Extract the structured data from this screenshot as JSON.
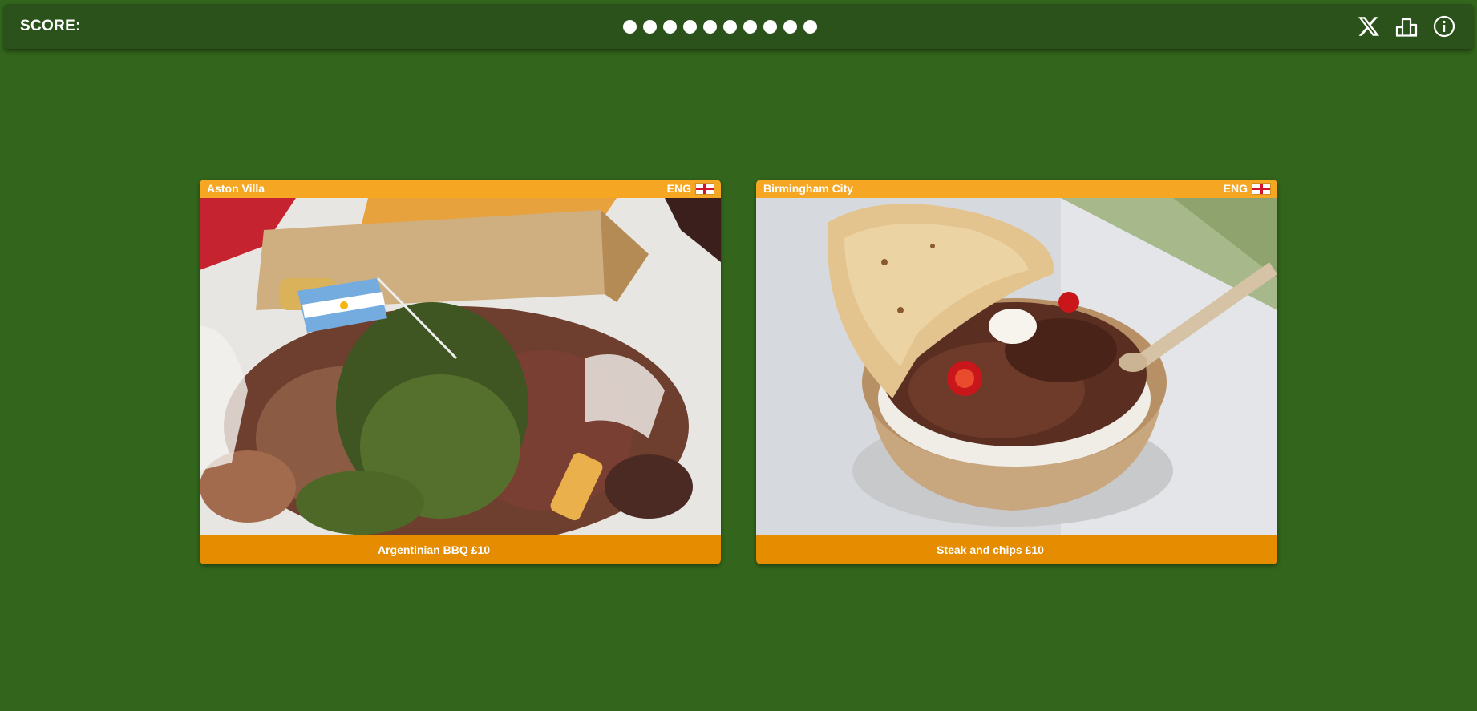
{
  "header": {
    "score_label": "SCORE:",
    "progress_dots": 10,
    "icons": [
      "x-logo-icon",
      "leaderboard-icon",
      "info-icon"
    ]
  },
  "cards": [
    {
      "club": "Aston Villa",
      "country": "ENG",
      "flag": "england-flag-icon",
      "photo": "argentinian-bbq-photo",
      "caption": "Argentinian BBQ £10"
    },
    {
      "club": "Birmingham City",
      "country": "ENG",
      "flag": "england-flag-icon",
      "photo": "steak-and-chips-photo",
      "caption": "Steak and chips £10"
    }
  ],
  "colors": {
    "background": "#33661c",
    "topbar": "#2a521a",
    "card_header": "#f5a724",
    "card_footer": "#e68c00",
    "text": "#ffffff"
  }
}
